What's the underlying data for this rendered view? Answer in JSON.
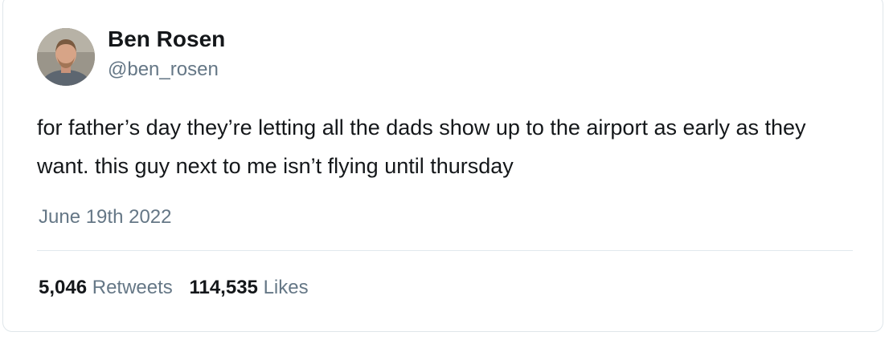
{
  "tweet": {
    "author_name": "Ben Rosen",
    "author_handle": "@ben_rosen",
    "text": "for father’s day they’re letting all the dads show up to the airport as early as they want. this guy next to me isn’t flying until thursday",
    "date": "June 19th 2022",
    "retweets_count": "5,046",
    "retweets_label": "Retweets",
    "likes_count": "114,535",
    "likes_label": "Likes"
  },
  "colors": {
    "text_primary": "#14171a",
    "text_secondary": "#657786",
    "border": "#dfe6ea"
  }
}
